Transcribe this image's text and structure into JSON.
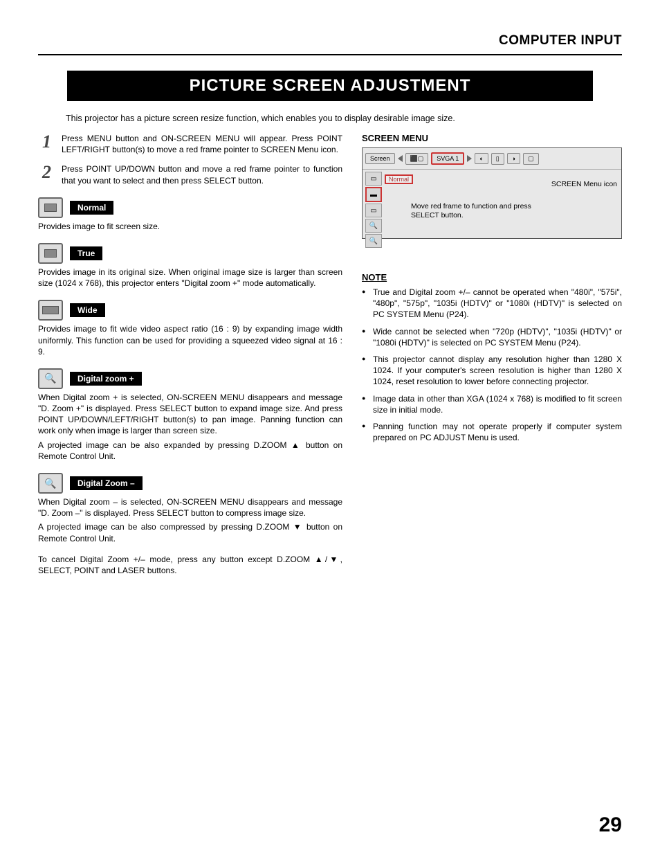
{
  "header": {
    "category": "COMPUTER INPUT"
  },
  "title": "PICTURE SCREEN ADJUSTMENT",
  "intro": "This projector has a picture screen resize function, which enables you to display desirable image size.",
  "steps": [
    {
      "num": "1",
      "text": "Press MENU button and ON-SCREEN MENU will appear.  Press POINT LEFT/RIGHT button(s) to move a red frame pointer to SCREEN Menu icon."
    },
    {
      "num": "2",
      "text": "Press POINT UP/DOWN button and move a red frame pointer to function that you want to select and then press SELECT button."
    }
  ],
  "modes": {
    "normal": {
      "label": "Normal",
      "desc": "Provides image to fit screen size."
    },
    "true": {
      "label": "True",
      "desc": "Provides image in its original size.  When original image size is larger than screen size (1024 x 768), this projector enters \"Digital zoom +\" mode automatically."
    },
    "wide": {
      "label": "Wide",
      "desc": "Provides image to fit wide video aspect ratio (16 : 9) by expanding image width uniformly.  This function can be used for providing a squeezed video signal at 16 : 9."
    },
    "zoomp": {
      "label": "Digital zoom +",
      "desc": "When Digital zoom + is selected, ON-SCREEN MENU disappears and message \"D. Zoom +\" is displayed.  Press SELECT button to expand image size.  And press POINT UP/DOWN/LEFT/RIGHT button(s) to pan image.  Panning function can work only when image is larger than screen size.",
      "desc2": "A projected image can be also expanded by pressing D.ZOOM ▲ button on Remote Control Unit."
    },
    "zoomm": {
      "label": "Digital Zoom –",
      "desc": "When Digital zoom – is selected, ON-SCREEN MENU disappears and message \"D. Zoom –\" is displayed.  Press SELECT button to compress image size.",
      "desc2": "A projected image can be also compressed by pressing D.ZOOM ▼ button on Remote Control Unit."
    }
  },
  "cancel_text": "To cancel Digital Zoom +/– mode, press any button except D.ZOOM ▲/▼, SELECT, POINT and LASER buttons.",
  "screen_menu": {
    "title": "SCREEN MENU",
    "tab_screen": "Screen",
    "tab_svga": "SVGA 1",
    "normal_label": "Normal",
    "callout_icon": "SCREEN Menu icon",
    "callout_move": "Move red frame to function and press SELECT button."
  },
  "note": {
    "title": "NOTE",
    "items": [
      "True and Digital zoom +/– cannot be operated when \"480i\", \"575i\", \"480p\", \"575p\", \"1035i (HDTV)\" or \"1080i (HDTV)\" is selected on PC SYSTEM Menu  (P24).",
      "Wide cannot be selected when \"720p (HDTV)\", \"1035i (HDTV)\" or \"1080i (HDTV)\" is selected on PC SYSTEM Menu  (P24).",
      "This projector cannot display any resolution higher than 1280 X 1024.  If your computer's screen resolution is higher than 1280 X 1024, reset resolution to lower before connecting projector.",
      "Image data in other than XGA (1024 x 768) is modified to fit screen size in initial mode.",
      "Panning function may not operate properly if computer system prepared on PC ADJUST Menu is used."
    ]
  },
  "page_number": "29"
}
